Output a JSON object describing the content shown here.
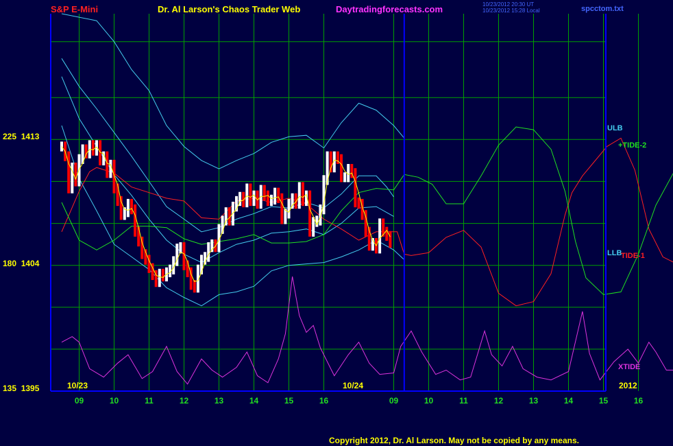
{
  "header": {
    "left_title": "S&P E-Mini",
    "center_title": "Dr. Al Larson's Chaos Trader Web",
    "site": "Daytradingforecasts.com",
    "updated_line1": "10/23/2012 20:30 UT",
    "updated_line2": "10/23/2012 15:28 Local",
    "filename": "spcctom.txt"
  },
  "footer": {
    "copyright": "Copyright 2012, Dr. Al Larson. May not be copied by any means."
  },
  "colors": {
    "background": "#000040",
    "grid": "#00a000",
    "frame": "#0000ff",
    "price_up": "#ffffff",
    "price_down": "#ff0000",
    "fast_avg": "#ffff00",
    "bands": "#44ccee",
    "tide1": "#ff2020",
    "tide2": "#20e020",
    "xtide": "#dd33dd",
    "title_red": "#ff2020",
    "title_yellow": "#ffff00",
    "title_magenta": "#ff33ff",
    "copyright": "#ffff00"
  },
  "chart_data": {
    "type": "line",
    "title": "S&P E-Mini",
    "y_ticks": [
      {
        "label": "225  1413",
        "index": 225,
        "price": 1413
      },
      {
        "label": "180  1404",
        "index": 180,
        "price": 1404
      },
      {
        "label": "135  1395",
        "index": 135,
        "price": 1395
      }
    ],
    "y_range": {
      "index": [
        135,
        270
      ],
      "price": [
        1395,
        1422
      ]
    },
    "date_labels": [
      "10/23",
      "10/24",
      "2012"
    ],
    "x_ticks": [
      "09",
      "10",
      "11",
      "12",
      "13",
      "14",
      "15",
      "16",
      "09",
      "10",
      "11",
      "12",
      "13",
      "14",
      "15",
      "16"
    ],
    "x_range_hours": [
      0,
      16
    ],
    "series_labels": {
      "ulb": "ULB",
      "llb": "LLB",
      "tide2": "+TIDE-2",
      "tide1": "TIDE-1",
      "xtide": "XTIDE"
    },
    "price_close": [
      [
        0.0,
        1412.5
      ],
      [
        0.1,
        1411.8
      ],
      [
        0.2,
        1409.5
      ],
      [
        0.3,
        1411.0
      ],
      [
        0.4,
        1410.0
      ],
      [
        0.5,
        1411.6
      ],
      [
        0.6,
        1412.3
      ],
      [
        0.7,
        1412.0
      ],
      [
        0.8,
        1412.6
      ],
      [
        0.9,
        1412.2
      ],
      [
        1.0,
        1412.6
      ],
      [
        1.1,
        1411.5
      ],
      [
        1.2,
        1411.8
      ],
      [
        1.3,
        1410.6
      ],
      [
        1.4,
        1411.2
      ],
      [
        1.5,
        1409.5
      ],
      [
        1.6,
        1408.6
      ],
      [
        1.7,
        1407.6
      ],
      [
        1.8,
        1407.8
      ],
      [
        1.9,
        1408.4
      ],
      [
        2.0,
        1408.0
      ],
      [
        2.1,
        1406.4
      ],
      [
        2.2,
        1405.7
      ],
      [
        2.3,
        1404.8
      ],
      [
        2.4,
        1404.4
      ],
      [
        2.5,
        1403.8
      ],
      [
        2.6,
        1403.3
      ],
      [
        2.7,
        1402.8
      ],
      [
        2.8,
        1403.4
      ],
      [
        2.9,
        1403.2
      ],
      [
        3.0,
        1403.5
      ],
      [
        3.1,
        1403.7
      ],
      [
        3.2,
        1404.3
      ],
      [
        3.3,
        1405.2
      ],
      [
        3.4,
        1405.3
      ],
      [
        3.5,
        1404.0
      ],
      [
        3.6,
        1403.5
      ],
      [
        3.7,
        1402.6
      ],
      [
        3.8,
        1402.4
      ],
      [
        3.9,
        1403.7
      ],
      [
        4.0,
        1404.4
      ],
      [
        4.1,
        1404.6
      ],
      [
        4.2,
        1405.3
      ],
      [
        4.3,
        1405.5
      ],
      [
        4.4,
        1405.3
      ],
      [
        4.5,
        1406.6
      ],
      [
        4.6,
        1407.2
      ],
      [
        4.7,
        1407.8
      ],
      [
        4.8,
        1407.2
      ],
      [
        4.9,
        1408.2
      ],
      [
        5.0,
        1408.6
      ],
      [
        5.1,
        1408.9
      ],
      [
        5.2,
        1408.5
      ],
      [
        5.3,
        1409.5
      ],
      [
        5.4,
        1408.6
      ],
      [
        5.5,
        1409.0
      ],
      [
        5.6,
        1408.4
      ],
      [
        5.7,
        1409.4
      ],
      [
        5.8,
        1409.0
      ],
      [
        5.9,
        1408.6
      ],
      [
        6.0,
        1408.7
      ],
      [
        6.1,
        1409.2
      ],
      [
        6.2,
        1408.8
      ],
      [
        6.3,
        1407.3
      ],
      [
        6.4,
        1407.7
      ],
      [
        6.5,
        1408.4
      ],
      [
        6.6,
        1408.8
      ],
      [
        6.7,
        1408.4
      ],
      [
        6.8,
        1409.6
      ],
      [
        6.9,
        1408.6
      ],
      [
        7.0,
        1409.0
      ],
      [
        7.1,
        1406.4
      ],
      [
        7.2,
        1407.1
      ],
      [
        7.3,
        1407.2
      ],
      [
        7.4,
        1408.0
      ],
      [
        7.5,
        1410.1
      ],
      [
        7.6,
        1411.8
      ],
      [
        7.7,
        1411.0
      ],
      [
        7.8,
        1411.8
      ],
      [
        7.9,
        1411.6
      ],
      [
        8.0,
        1410.3
      ],
      [
        8.1,
        1410.3
      ],
      [
        8.2,
        1410.9
      ],
      [
        8.3,
        1410.6
      ],
      [
        8.4,
        1408.5
      ],
      [
        8.5,
        1408.4
      ],
      [
        8.6,
        1407.6
      ],
      [
        8.7,
        1406.4
      ],
      [
        8.8,
        1405.4
      ],
      [
        8.9,
        1405.6
      ],
      [
        9.0,
        1405.2
      ],
      [
        9.1,
        1407.0
      ],
      [
        9.2,
        1406.4
      ],
      [
        9.3,
        1406.1
      ],
      [
        9.4,
        1405.6
      ]
    ],
    "bands": [
      {
        "name": "outer",
        "points": [
          [
            0,
            1422
          ],
          [
            1,
            1421.5
          ],
          [
            1.5,
            1420
          ],
          [
            2,
            1418
          ],
          [
            2.5,
            1416.5
          ],
          [
            3,
            1414
          ],
          [
            3.5,
            1412.5
          ],
          [
            4,
            1411.5
          ],
          [
            4.5,
            1410.9
          ],
          [
            5,
            1411.5
          ],
          [
            5.5,
            1412
          ],
          [
            6,
            1412.8
          ],
          [
            6.5,
            1413.2
          ],
          [
            7,
            1413.3
          ],
          [
            7.5,
            1412.4
          ],
          [
            8,
            1414.2
          ],
          [
            8.5,
            1415.6
          ],
          [
            9,
            1415.1
          ],
          [
            9.5,
            1414.0
          ],
          [
            9.8,
            1413.1
          ]
        ]
      },
      {
        "name": "mid_upper",
        "points": [
          [
            0,
            1418.8
          ],
          [
            0.5,
            1416.8
          ],
          [
            1,
            1415.2
          ],
          [
            1.5,
            1413.5
          ],
          [
            2,
            1411.8
          ],
          [
            2.5,
            1410
          ],
          [
            3,
            1408.2
          ],
          [
            3.5,
            1407.3
          ],
          [
            4,
            1406.4
          ],
          [
            4.5,
            1406.7
          ],
          [
            5,
            1407.3
          ],
          [
            5.5,
            1407.7
          ],
          [
            6,
            1408.2
          ],
          [
            6.5,
            1408.1
          ],
          [
            7,
            1408.5
          ],
          [
            7.5,
            1408.1
          ],
          [
            8,
            1409.1
          ],
          [
            8.5,
            1410.4
          ],
          [
            9,
            1410.4
          ],
          [
            9.3,
            1409.6
          ],
          [
            9.5,
            1408.9
          ]
        ]
      },
      {
        "name": "mid_lower",
        "points": [
          [
            0,
            1417.5
          ],
          [
            0.5,
            1414.5
          ],
          [
            1,
            1412.5
          ],
          [
            1.5,
            1410.5
          ],
          [
            2,
            1409
          ],
          [
            2.5,
            1407.3
          ],
          [
            3,
            1405.8
          ],
          [
            3.5,
            1404.8
          ],
          [
            4,
            1404.2
          ],
          [
            4.5,
            1404.9
          ],
          [
            5,
            1405.5
          ],
          [
            5.5,
            1405.8
          ],
          [
            6,
            1406.3
          ],
          [
            6.5,
            1406.4
          ],
          [
            7,
            1406.6
          ],
          [
            7.5,
            1406.2
          ],
          [
            8,
            1407.0
          ],
          [
            8.5,
            1408.1
          ],
          [
            9,
            1408.2
          ],
          [
            9.5,
            1407.5
          ]
        ]
      },
      {
        "name": "inner",
        "points": [
          [
            0,
            1414
          ],
          [
            0.5,
            1410.2
          ],
          [
            1,
            1407.9
          ],
          [
            1.5,
            1405.5
          ],
          [
            2,
            1404.6
          ],
          [
            2.5,
            1403.7
          ],
          [
            3,
            1402.4
          ],
          [
            3.5,
            1401.7
          ],
          [
            4,
            1401.1
          ],
          [
            4.5,
            1401.9
          ],
          [
            5,
            1402.1
          ],
          [
            5.5,
            1402.5
          ],
          [
            6,
            1403.6
          ],
          [
            6.5,
            1404
          ],
          [
            7,
            1404.1
          ],
          [
            7.5,
            1404.2
          ],
          [
            8,
            1404.6
          ],
          [
            8.5,
            1405.1
          ],
          [
            9,
            1405.8
          ],
          [
            9.5,
            1405.1
          ],
          [
            9.8,
            1404.4
          ]
        ]
      }
    ],
    "tide1": [
      [
        0,
        1406.4
      ],
      [
        0.5,
        1409.3
      ],
      [
        0.8,
        1410.7
      ],
      [
        1,
        1411
      ],
      [
        1.5,
        1410.6
      ],
      [
        2,
        1409.6
      ],
      [
        2.5,
        1409.2
      ],
      [
        3,
        1408.8
      ],
      [
        3.5,
        1408.6
      ],
      [
        4,
        1407.4
      ],
      [
        4.5,
        1407.3
      ],
      [
        5,
        1408.6
      ],
      [
        5.5,
        1408.8
      ],
      [
        6,
        1408.5
      ],
      [
        6.5,
        1408.8
      ],
      [
        7,
        1408.4
      ],
      [
        7.5,
        1407.3
      ],
      [
        8,
        1406.6
      ],
      [
        8.5,
        1405.8
      ],
      [
        9,
        1406.4
      ],
      [
        9.6,
        1406.4
      ],
      [
        9.8,
        1404.8
      ],
      [
        10,
        1404.7
      ],
      [
        10.5,
        1404.9
      ],
      [
        11,
        1406
      ],
      [
        11.5,
        1406.5
      ],
      [
        12,
        1405.3
      ],
      [
        12.5,
        1402
      ],
      [
        13,
        1401.1
      ],
      [
        13.5,
        1401.4
      ],
      [
        14,
        1403.4
      ],
      [
        14.4,
        1407.6
      ],
      [
        14.6,
        1409.2
      ],
      [
        14.9,
        1410.4
      ],
      [
        15.2,
        1411.3
      ],
      [
        15.6,
        1412.5
      ],
      [
        16,
        1413.1
      ],
      [
        16.4,
        1410.8
      ],
      [
        16.8,
        1406.6
      ],
      [
        17.2,
        1404.6
      ],
      [
        17.6,
        1404.1
      ]
    ],
    "tide2": [
      [
        0,
        1408.5
      ],
      [
        0.5,
        1405.8
      ],
      [
        1,
        1405.1
      ],
      [
        1.5,
        1405.8
      ],
      [
        2,
        1406.8
      ],
      [
        2.5,
        1406.8
      ],
      [
        3,
        1406.7
      ],
      [
        3.5,
        1405.9
      ],
      [
        4,
        1405.5
      ],
      [
        4.5,
        1405.7
      ],
      [
        5,
        1405.9
      ],
      [
        5.5,
        1406.2
      ],
      [
        6,
        1405.6
      ],
      [
        6.5,
        1405.6
      ],
      [
        7,
        1405.7
      ],
      [
        7.5,
        1406.2
      ],
      [
        8,
        1407.9
      ],
      [
        8.5,
        1409.2
      ],
      [
        9.0,
        1409.5
      ],
      [
        9.5,
        1409.4
      ],
      [
        9.8,
        1410.5
      ],
      [
        10.2,
        1410.3
      ],
      [
        10.6,
        1409.8
      ],
      [
        11,
        1408.4
      ],
      [
        11.5,
        1408.4
      ],
      [
        12,
        1410.4
      ],
      [
        12.5,
        1412.6
      ],
      [
        13,
        1413.9
      ],
      [
        13.5,
        1413.7
      ],
      [
        14,
        1412.3
      ],
      [
        14.4,
        1409.3
      ],
      [
        14.7,
        1405.7
      ],
      [
        15.0,
        1403.1
      ],
      [
        15.5,
        1401.9
      ],
      [
        16,
        1402.1
      ],
      [
        16.5,
        1404.8
      ],
      [
        17,
        1408.3
      ],
      [
        17.5,
        1410.6
      ],
      [
        18,
        1411.5
      ],
      [
        18.3,
        1412.2
      ],
      [
        18.6,
        1412.4
      ]
    ],
    "xtide": [
      [
        0,
        1398.5
      ],
      [
        0.3,
        1398.9
      ],
      [
        0.5,
        1398.5
      ],
      [
        0.8,
        1396.6
      ],
      [
        1.2,
        1396
      ],
      [
        1.6,
        1397
      ],
      [
        1.9,
        1397.6
      ],
      [
        2.3,
        1395.9
      ],
      [
        2.6,
        1396.4
      ],
      [
        3.0,
        1398.2
      ],
      [
        3.3,
        1396.4
      ],
      [
        3.6,
        1395.5
      ],
      [
        4,
        1397.3
      ],
      [
        4.3,
        1396.5
      ],
      [
        4.6,
        1396
      ],
      [
        5,
        1396.7
      ],
      [
        5.3,
        1397.8
      ],
      [
        5.6,
        1396.1
      ],
      [
        5.9,
        1395.6
      ],
      [
        6.2,
        1397.3
      ],
      [
        6.4,
        1399.1
      ],
      [
        6.6,
        1403.2
      ],
      [
        6.8,
        1400.4
      ],
      [
        7,
        1399.2
      ],
      [
        7.2,
        1399.7
      ],
      [
        7.4,
        1398.1
      ],
      [
        7.8,
        1396.1
      ],
      [
        8.2,
        1397.6
      ],
      [
        8.5,
        1398.5
      ],
      [
        8.8,
        1397.0
      ],
      [
        9.1,
        1396.2
      ],
      [
        9.5,
        1396.3
      ],
      [
        9.7,
        1398.2
      ],
      [
        10.0,
        1399.3
      ],
      [
        10.3,
        1397.8
      ],
      [
        10.7,
        1396.2
      ],
      [
        11,
        1396.5
      ],
      [
        11.4,
        1395.8
      ],
      [
        11.7,
        1396.0
      ],
      [
        12.1,
        1399.3
      ],
      [
        12.3,
        1397.6
      ],
      [
        12.6,
        1396.8
      ],
      [
        12.9,
        1398.2
      ],
      [
        13.2,
        1396.6
      ],
      [
        13.6,
        1396.0
      ],
      [
        14,
        1395.8
      ],
      [
        14.5,
        1396.4
      ],
      [
        14.9,
        1400.7
      ],
      [
        15.1,
        1397.7
      ],
      [
        15.4,
        1395.8
      ],
      [
        15.8,
        1397.1
      ],
      [
        16.2,
        1398.0
      ],
      [
        16.5,
        1397.0
      ],
      [
        16.8,
        1398.5
      ],
      [
        17.0,
        1397.8
      ],
      [
        17.3,
        1396.5
      ],
      [
        17.7,
        1396.5
      ]
    ]
  }
}
